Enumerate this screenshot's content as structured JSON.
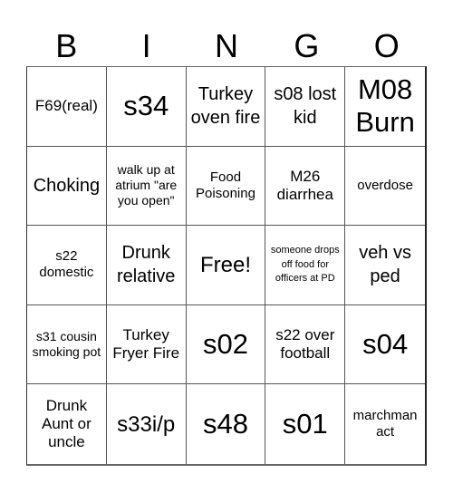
{
  "header": {
    "letters": [
      "B",
      "I",
      "N",
      "G",
      "O"
    ]
  },
  "cells": [
    [
      "F69(real)",
      "s34",
      "Turkey oven fire",
      "s08 lost kid",
      "M08 Burn"
    ],
    [
      "Choking",
      "walk up at atrium \"are you open\"",
      "Food Poisoning",
      "M26 diarrhea",
      "overdose"
    ],
    [
      "s22 domestic",
      "Drunk relative",
      "Free!",
      "someone drops off food for officers at PD",
      "veh vs ped"
    ],
    [
      "s31 cousin smoking pot",
      "Turkey Fryer Fire",
      "s02",
      "s22 over football",
      "s04"
    ],
    [
      "Drunk Aunt or uncle",
      "s33i/p",
      "s48",
      "s01",
      "marchman act"
    ]
  ]
}
